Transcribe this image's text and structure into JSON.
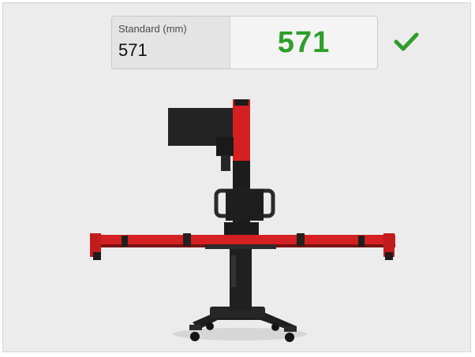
{
  "measurement": {
    "standard_label": "Standard (mm)",
    "standard_value": "571",
    "measured_value": "571",
    "status_icon": "checkmark-icon",
    "status_color": "#2e9e2a"
  },
  "image": {
    "subject": "calibration-frame",
    "accent_color": "#e02020"
  }
}
